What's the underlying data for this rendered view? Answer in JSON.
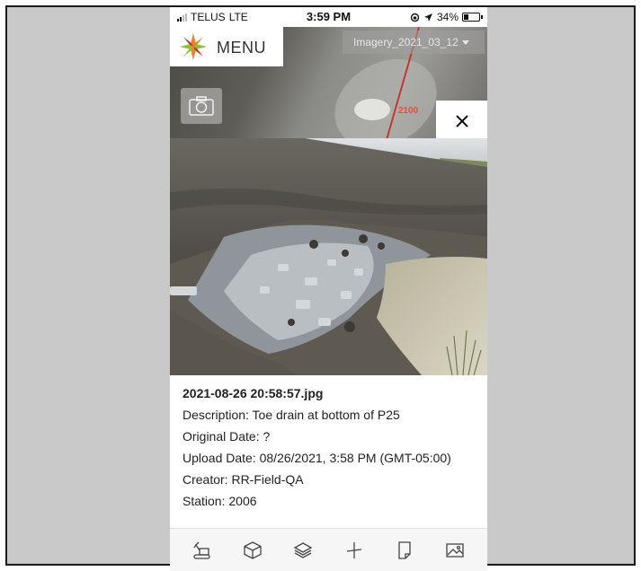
{
  "status_bar": {
    "carrier": "TELUS",
    "network": "LTE",
    "time": "3:59 PM",
    "battery": "34%",
    "battery_level": 0.34
  },
  "map": {
    "menu_label": "MENU",
    "imagery_select": "Imagery_2021_03_12",
    "station_marker": "2100",
    "line_color": "#c0392b"
  },
  "photo": {
    "filename": "2021-08-26 20:58:57.jpg",
    "description": "Description: Toe drain at bottom of P25",
    "original_date": "Original Date: ?",
    "upload_date": "Upload Date: 08/26/2021, 3:58 PM (GMT-05:00)",
    "creator": "Creator: RR-Field-QA",
    "station": "Station: 2006"
  },
  "toolbar": {
    "icons": [
      "excavator-icon",
      "cube-icon",
      "layers-icon",
      "survey-icon",
      "page-icon",
      "image-icon"
    ]
  },
  "colors": {
    "background_frame": "#c9c9c9",
    "logo_orange": "#e8832a",
    "logo_green": "#8bbf3c",
    "logo_red": "#c0392b"
  }
}
